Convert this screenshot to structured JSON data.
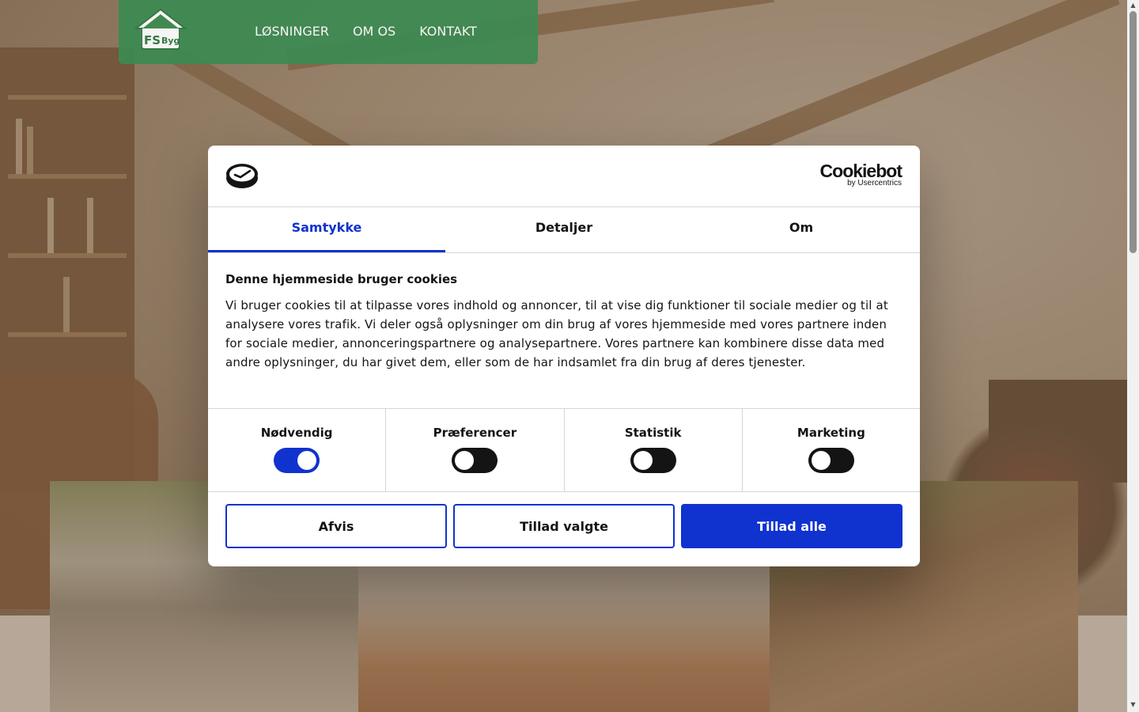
{
  "header": {
    "logo_text": "FS Byg",
    "nav": [
      {
        "label": "LØSNINGER"
      },
      {
        "label": "OM OS"
      },
      {
        "label": "KONTAKT"
      }
    ]
  },
  "dialog": {
    "brand_main": "Cookiebot",
    "brand_sub": "by Usercentrics",
    "tabs": [
      {
        "label": "Samtykke",
        "active": true
      },
      {
        "label": "Detaljer",
        "active": false
      },
      {
        "label": "Om",
        "active": false
      }
    ],
    "title": "Denne hjemmeside bruger cookies",
    "text": "Vi bruger cookies til at tilpasse vores indhold og annoncer, til at vise dig funktioner til sociale medier og til at analysere vores trafik. Vi deler også oplysninger om din brug af vores hjemmeside med vores partnere inden for sociale medier, annonceringspartnere og analysepartnere. Vores partnere kan kombinere disse data med andre oplysninger, du har givet dem, eller som de har indsamlet fra din brug af deres tjenester.",
    "toggles": [
      {
        "label": "Nødvendig",
        "on": true
      },
      {
        "label": "Præferencer",
        "on": false
      },
      {
        "label": "Statistik",
        "on": false
      },
      {
        "label": "Marketing",
        "on": false
      }
    ],
    "buttons": {
      "deny": "Afvis",
      "allow_selected": "Tillad valgte",
      "allow_all": "Tillad alle"
    }
  },
  "colors": {
    "accent": "#1032cf",
    "header_green": "#3d8a52",
    "text": "#141414"
  }
}
